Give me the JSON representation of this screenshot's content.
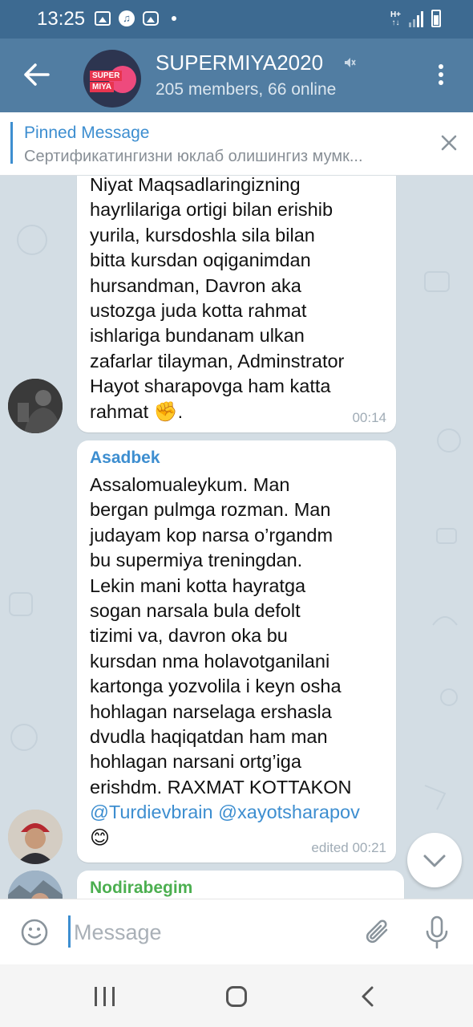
{
  "status_bar": {
    "time": "13:25",
    "icons": [
      "gallery-icon",
      "tiktok-icon",
      "instagram-icon",
      "notification-dot"
    ],
    "network": [
      "H+",
      "↑↓"
    ]
  },
  "header": {
    "title": "SUPERMIYA2020",
    "subtitle": "205 members, 66 online",
    "avatar_text": [
      "SUPER",
      "MIYA"
    ],
    "muted": true
  },
  "pinned": {
    "title": "Pinned Message",
    "text": "Сертификатингизни юклаб олишингиз мумк..."
  },
  "messages": [
    {
      "author": "",
      "lines": [
        "Niyat Maqsadlaringizning",
        "hayrlilariga ortigi bilan erishib",
        "yurila, kursdoshla sila bilan",
        "bitta kursdan oqiganimdan",
        "hursandman, Davron aka",
        "ustozga juda kotta rahmat",
        "ishlariga bundanam ulkan",
        "zafarlar tilayman, Adminstrator",
        "Hayot sharapovga ham katta"
      ],
      "last_line": "rahmat",
      "emoji": "✊",
      "tail": ".",
      "time": "00:14"
    },
    {
      "author": "Asadbek",
      "author_color": "#3d8ed0",
      "lines": [
        "Assalomualeykum. Man",
        "bergan pulmga rozman. Man",
        "judayam kop narsa o’rgandm",
        "bu supermiya treningdan.",
        "Lekin mani kotta hayratga",
        "sogan narsala bula defolt",
        "tizimi va, davron oka bu",
        "kursdan nma holavotganilani",
        "kartonga yozvolila i keyn osha",
        "hohlagan narselaga ershasla",
        "dvudla haqiqatdan ham man",
        "hohlagan narsani ortg’iga",
        "erishdm. RAXMAT KOTTAKON"
      ],
      "mentions": [
        "@Turdievbrain",
        "@xayotsharapov"
      ],
      "emoji": "😊",
      "time": "edited 00:21"
    },
    {
      "author": "Nodirabegim",
      "author_color": "#4caf50"
    }
  ],
  "input": {
    "placeholder": "Message"
  },
  "colors": {
    "header": "#517da2",
    "status_bar": "#3d6a91",
    "accent": "#3d8ed0",
    "chat_bg": "#d3dde4"
  }
}
